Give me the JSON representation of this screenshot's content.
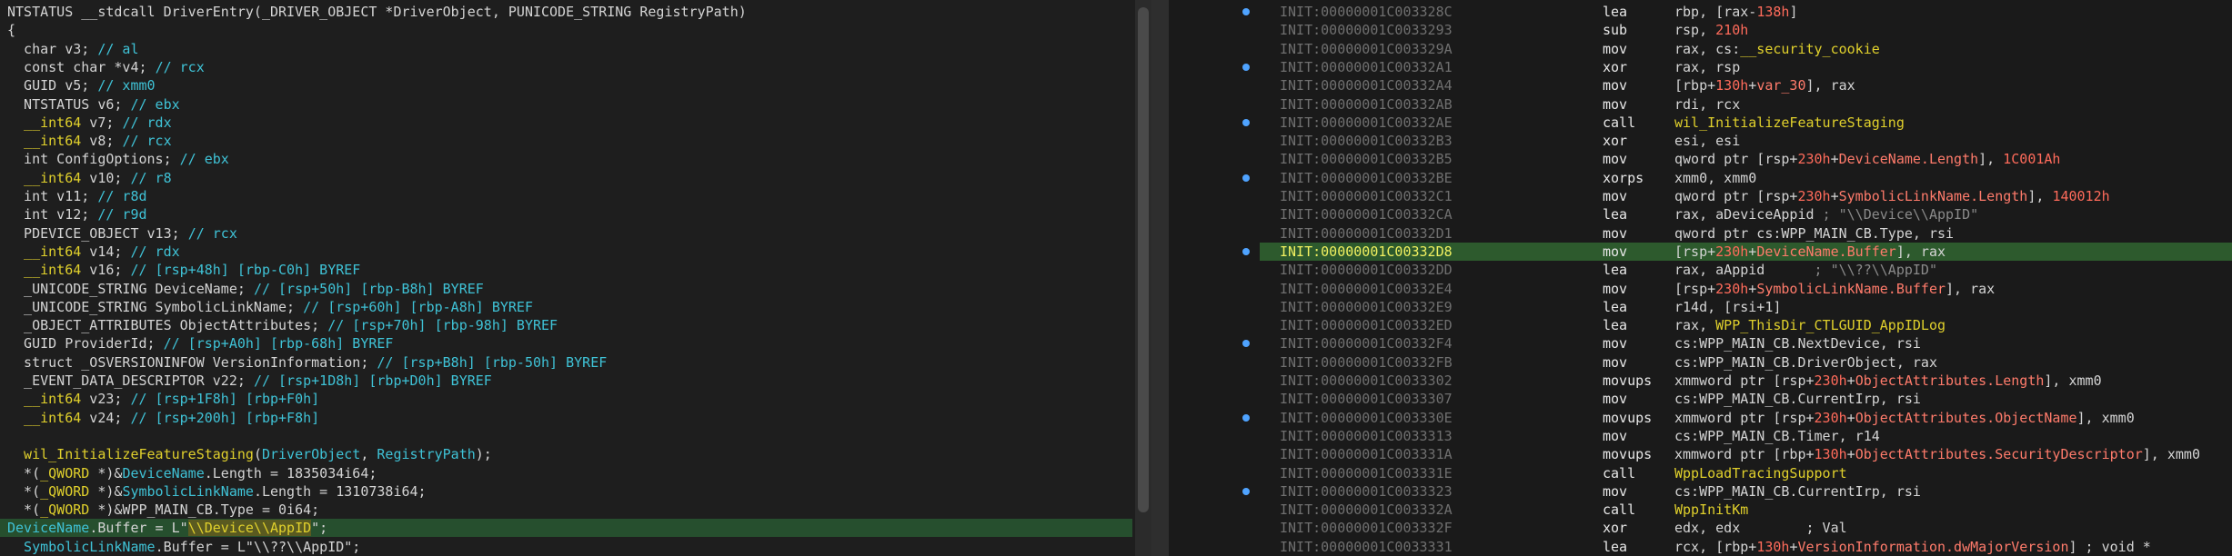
{
  "pseudocode": {
    "lines": [
      {
        "parts": [
          {
            "t": "NTSTATUS __stdcall DriverEntry(_DRIVER_OBJECT *DriverObject, PUNICODE_STRING RegistryPath)",
            "c": "kw"
          }
        ]
      },
      {
        "parts": [
          {
            "t": "{",
            "c": "kw"
          }
        ]
      },
      {
        "parts": [
          {
            "t": "  char v3; ",
            "c": "kw"
          },
          {
            "t": "// al",
            "c": "cmt"
          }
        ]
      },
      {
        "parts": [
          {
            "t": "  const char *v4; ",
            "c": "kw"
          },
          {
            "t": "// rcx",
            "c": "cmt"
          }
        ]
      },
      {
        "parts": [
          {
            "t": "  GUID v5; ",
            "c": "kw"
          },
          {
            "t": "// xmm0",
            "c": "cmt"
          }
        ]
      },
      {
        "parts": [
          {
            "t": "  NTSTATUS v6; ",
            "c": "kw"
          },
          {
            "t": "// ebx",
            "c": "cmt"
          }
        ]
      },
      {
        "parts": [
          {
            "t": "  __int64",
            "c": "fn"
          },
          {
            "t": " v7; ",
            "c": "kw"
          },
          {
            "t": "// rdx",
            "c": "cmt"
          }
        ]
      },
      {
        "parts": [
          {
            "t": "  __int64",
            "c": "fn"
          },
          {
            "t": " v8; ",
            "c": "kw"
          },
          {
            "t": "// rcx",
            "c": "cmt"
          }
        ]
      },
      {
        "parts": [
          {
            "t": "  int ConfigOptions; ",
            "c": "kw"
          },
          {
            "t": "// ebx",
            "c": "cmt"
          }
        ]
      },
      {
        "parts": [
          {
            "t": "  __int64",
            "c": "fn"
          },
          {
            "t": " v10; ",
            "c": "kw"
          },
          {
            "t": "// r8",
            "c": "cmt"
          }
        ]
      },
      {
        "parts": [
          {
            "t": "  int v11; ",
            "c": "kw"
          },
          {
            "t": "// r8d",
            "c": "cmt"
          }
        ]
      },
      {
        "parts": [
          {
            "t": "  int v12; ",
            "c": "kw"
          },
          {
            "t": "// r9d",
            "c": "cmt"
          }
        ]
      },
      {
        "parts": [
          {
            "t": "  PDEVICE_OBJECT v13; ",
            "c": "kw"
          },
          {
            "t": "// rcx",
            "c": "cmt"
          }
        ]
      },
      {
        "parts": [
          {
            "t": "  __int64",
            "c": "fn"
          },
          {
            "t": " v14; ",
            "c": "kw"
          },
          {
            "t": "// rdx",
            "c": "cmt"
          }
        ]
      },
      {
        "parts": [
          {
            "t": "  __int64",
            "c": "fn"
          },
          {
            "t": " v16; ",
            "c": "kw"
          },
          {
            "t": "// [rsp+48h] [rbp-C0h] BYREF",
            "c": "cmt"
          }
        ]
      },
      {
        "parts": [
          {
            "t": "  _UNICODE_STRING DeviceName; ",
            "c": "kw"
          },
          {
            "t": "// [rsp+50h] [rbp-B8h] BYREF",
            "c": "cmt"
          }
        ]
      },
      {
        "parts": [
          {
            "t": "  _UNICODE_STRING SymbolicLinkName; ",
            "c": "kw"
          },
          {
            "t": "// [rsp+60h] [rbp-A8h] BYREF",
            "c": "cmt"
          }
        ]
      },
      {
        "parts": [
          {
            "t": "  _OBJECT_ATTRIBUTES ObjectAttributes; ",
            "c": "kw"
          },
          {
            "t": "// [rsp+70h] [rbp-98h] BYREF",
            "c": "cmt"
          }
        ]
      },
      {
        "parts": [
          {
            "t": "  GUID ProviderId; ",
            "c": "kw"
          },
          {
            "t": "// [rsp+A0h] [rbp-68h] BYREF",
            "c": "cmt"
          }
        ]
      },
      {
        "parts": [
          {
            "t": "  struct _OSVERSIONINFOW VersionInformation; ",
            "c": "kw"
          },
          {
            "t": "// [rsp+B8h] [rbp-50h] BYREF",
            "c": "cmt"
          }
        ]
      },
      {
        "parts": [
          {
            "t": "  _EVENT_DATA_DESCRIPTOR v22; ",
            "c": "kw"
          },
          {
            "t": "// [rsp+1D8h] [rbp+D0h] BYREF",
            "c": "cmt"
          }
        ]
      },
      {
        "parts": [
          {
            "t": "  __int64",
            "c": "fn"
          },
          {
            "t": " v23; ",
            "c": "kw"
          },
          {
            "t": "// [rsp+1F8h] [rbp+F0h]",
            "c": "cmt"
          }
        ]
      },
      {
        "parts": [
          {
            "t": "  __int64",
            "c": "fn"
          },
          {
            "t": " v24; ",
            "c": "kw"
          },
          {
            "t": "// [rsp+200h] [rbp+F8h]",
            "c": "cmt"
          }
        ]
      },
      {
        "parts": [
          {
            "t": "",
            "c": "kw"
          }
        ]
      },
      {
        "parts": [
          {
            "t": "  wil_InitializeFeatureStaging",
            "c": "fn"
          },
          {
            "t": "(",
            "c": "kw"
          },
          {
            "t": "DriverObject",
            "c": "var"
          },
          {
            "t": ", ",
            "c": "kw"
          },
          {
            "t": "RegistryPath",
            "c": "var"
          },
          {
            "t": ");",
            "c": "kw"
          }
        ]
      },
      {
        "parts": [
          {
            "t": "  *(",
            "c": "kw"
          },
          {
            "t": "_QWORD",
            "c": "fn"
          },
          {
            "t": " *)&",
            "c": "kw"
          },
          {
            "t": "DeviceName",
            "c": "var"
          },
          {
            "t": ".Length = 1835034i64;",
            "c": "kw"
          }
        ]
      },
      {
        "parts": [
          {
            "t": "  *(",
            "c": "kw"
          },
          {
            "t": "_QWORD",
            "c": "fn"
          },
          {
            "t": " *)&",
            "c": "kw"
          },
          {
            "t": "SymbolicLinkName",
            "c": "var"
          },
          {
            "t": ".Length = 1310738i64;",
            "c": "kw"
          }
        ]
      },
      {
        "parts": [
          {
            "t": "  *(",
            "c": "kw"
          },
          {
            "t": "_QWORD",
            "c": "fn"
          },
          {
            "t": " *)&WPP_MAIN_CB.Type = 0i64;",
            "c": "kw"
          }
        ]
      },
      {
        "highlight": true,
        "parts": [
          {
            "t": "DeviceName",
            "c": "var"
          },
          {
            "t": ".Buffer = L\"",
            "c": "kw"
          },
          {
            "t": "\\\\Device\\\\AppID",
            "c": "strhl"
          },
          {
            "t": "\";",
            "c": "kw"
          }
        ]
      },
      {
        "parts": [
          {
            "t": "  SymbolicLinkName",
            "c": "var"
          },
          {
            "t": ".Buffer = L\"\\\\??\\\\AppID\";",
            "c": "kw"
          }
        ]
      }
    ]
  },
  "disasm": {
    "rows": [
      {
        "addr": "INIT:00000001C003328C",
        "mn": "lea",
        "ops": [
          {
            "t": "rbp, [rax-",
            "c": "kw"
          },
          {
            "t": "138h",
            "c": "red"
          },
          {
            "t": "]",
            "c": "kw"
          }
        ]
      },
      {
        "addr": "INIT:00000001C0033293",
        "mn": "sub",
        "ops": [
          {
            "t": "rsp, ",
            "c": "kw"
          },
          {
            "t": "210h",
            "c": "red"
          }
        ]
      },
      {
        "addr": "INIT:00000001C003329A",
        "mn": "mov",
        "ops": [
          {
            "t": "rax, cs:",
            "c": "kw"
          },
          {
            "t": "__security_cookie",
            "c": "sym"
          }
        ]
      },
      {
        "addr": "INIT:00000001C00332A1",
        "mn": "xor",
        "ops": [
          {
            "t": "rax, rsp",
            "c": "kw"
          }
        ]
      },
      {
        "addr": "INIT:00000001C00332A4",
        "mn": "mov",
        "ops": [
          {
            "t": "[rbp+",
            "c": "kw"
          },
          {
            "t": "130h",
            "c": "red"
          },
          {
            "t": "+",
            "c": "kw"
          },
          {
            "t": "var_30",
            "c": "offs"
          },
          {
            "t": "], rax",
            "c": "kw"
          }
        ]
      },
      {
        "addr": "INIT:00000001C00332AB",
        "mn": "mov",
        "ops": [
          {
            "t": "rdi, rcx",
            "c": "kw"
          }
        ]
      },
      {
        "addr": "INIT:00000001C00332AE",
        "mn": "call",
        "ops": [
          {
            "t": "wil_InitializeFeatureStaging",
            "c": "sym"
          }
        ]
      },
      {
        "addr": "INIT:00000001C00332B3",
        "mn": "xor",
        "ops": [
          {
            "t": "esi, esi",
            "c": "kw"
          }
        ]
      },
      {
        "addr": "INIT:00000001C00332B5",
        "mn": "mov",
        "ops": [
          {
            "t": "qword ptr [rsp+",
            "c": "kw"
          },
          {
            "t": "230h",
            "c": "red"
          },
          {
            "t": "+",
            "c": "kw"
          },
          {
            "t": "DeviceName.Length",
            "c": "offs"
          },
          {
            "t": "], ",
            "c": "kw"
          },
          {
            "t": "1C001Ah",
            "c": "red"
          }
        ]
      },
      {
        "addr": "INIT:00000001C00332BE",
        "mn": "xorps",
        "ops": [
          {
            "t": "xmm0, xmm0",
            "c": "kw"
          }
        ]
      },
      {
        "addr": "INIT:00000001C00332C1",
        "mn": "mov",
        "ops": [
          {
            "t": "qword ptr [rsp+",
            "c": "kw"
          },
          {
            "t": "230h",
            "c": "red"
          },
          {
            "t": "+",
            "c": "kw"
          },
          {
            "t": "SymbolicLinkName.Length",
            "c": "offs"
          },
          {
            "t": "], ",
            "c": "kw"
          },
          {
            "t": "140012h",
            "c": "red"
          }
        ]
      },
      {
        "addr": "INIT:00000001C00332CA",
        "mn": "lea",
        "ops": [
          {
            "t": "rax, aDeviceAppid ",
            "c": "kw"
          },
          {
            "t": "; \"\\\\Device\\\\AppID\"",
            "c": "gray"
          }
        ]
      },
      {
        "addr": "INIT:00000001C00332D1",
        "mn": "mov",
        "ops": [
          {
            "t": "qword ptr cs:WPP_MAIN_CB.Type, rsi",
            "c": "kw"
          }
        ]
      },
      {
        "addr": "INIT:00000001C00332D8",
        "mn": "mov",
        "highlight": true,
        "ops": [
          {
            "t": "[rsp+",
            "c": "kw"
          },
          {
            "t": "230h",
            "c": "red"
          },
          {
            "t": "+",
            "c": "kw"
          },
          {
            "t": "DeviceName.Buffer",
            "c": "offs"
          },
          {
            "t": "], rax",
            "c": "kw"
          }
        ]
      },
      {
        "addr": "INIT:00000001C00332DD",
        "mn": "lea",
        "ops": [
          {
            "t": "rax, aAppid      ",
            "c": "kw"
          },
          {
            "t": "; \"\\\\??\\\\AppID\"",
            "c": "gray"
          }
        ]
      },
      {
        "addr": "INIT:00000001C00332E4",
        "mn": "mov",
        "ops": [
          {
            "t": "[rsp+",
            "c": "kw"
          },
          {
            "t": "230h",
            "c": "red"
          },
          {
            "t": "+",
            "c": "kw"
          },
          {
            "t": "SymbolicLinkName.Buffer",
            "c": "offs"
          },
          {
            "t": "], rax",
            "c": "kw"
          }
        ]
      },
      {
        "addr": "INIT:00000001C00332E9",
        "mn": "lea",
        "ops": [
          {
            "t": "r14d, [rsi+1]",
            "c": "kw"
          }
        ]
      },
      {
        "addr": "INIT:00000001C00332ED",
        "mn": "lea",
        "ops": [
          {
            "t": "rax, ",
            "c": "kw"
          },
          {
            "t": "WPP_ThisDir_CTLGUID_AppIDLog",
            "c": "sym"
          }
        ]
      },
      {
        "addr": "INIT:00000001C00332F4",
        "mn": "mov",
        "ops": [
          {
            "t": "cs:WPP_MAIN_CB.NextDevice, rsi",
            "c": "kw"
          }
        ]
      },
      {
        "addr": "INIT:00000001C00332FB",
        "mn": "mov",
        "ops": [
          {
            "t": "cs:WPP_MAIN_CB.DriverObject, rax",
            "c": "kw"
          }
        ]
      },
      {
        "addr": "INIT:00000001C0033302",
        "mn": "movups",
        "ops": [
          {
            "t": "xmmword ptr [rsp+",
            "c": "kw"
          },
          {
            "t": "230h",
            "c": "red"
          },
          {
            "t": "+",
            "c": "kw"
          },
          {
            "t": "ObjectAttributes.Length",
            "c": "offs"
          },
          {
            "t": "], xmm0",
            "c": "kw"
          }
        ]
      },
      {
        "addr": "INIT:00000001C0033307",
        "mn": "mov",
        "ops": [
          {
            "t": "cs:WPP_MAIN_CB.CurrentIrp, rsi",
            "c": "kw"
          }
        ]
      },
      {
        "addr": "INIT:00000001C003330E",
        "mn": "movups",
        "ops": [
          {
            "t": "xmmword ptr [rsp+",
            "c": "kw"
          },
          {
            "t": "230h",
            "c": "red"
          },
          {
            "t": "+",
            "c": "kw"
          },
          {
            "t": "ObjectAttributes.ObjectName",
            "c": "offs"
          },
          {
            "t": "], xmm0",
            "c": "kw"
          }
        ]
      },
      {
        "addr": "INIT:00000001C0033313",
        "mn": "mov",
        "ops": [
          {
            "t": "cs:WPP_MAIN_CB.Timer, r14",
            "c": "kw"
          }
        ]
      },
      {
        "addr": "INIT:00000001C003331A",
        "mn": "movups",
        "ops": [
          {
            "t": "xmmword ptr [rbp+",
            "c": "kw"
          },
          {
            "t": "130h",
            "c": "red"
          },
          {
            "t": "+",
            "c": "kw"
          },
          {
            "t": "ObjectAttributes.SecurityDescriptor",
            "c": "offs"
          },
          {
            "t": "], xmm0",
            "c": "kw"
          }
        ]
      },
      {
        "addr": "INIT:00000001C003331E",
        "mn": "call",
        "ops": [
          {
            "t": "WppLoadTracingSupport",
            "c": "sym"
          }
        ]
      },
      {
        "addr": "INIT:00000001C0033323",
        "mn": "mov",
        "ops": [
          {
            "t": "cs:WPP_MAIN_CB.CurrentIrp, rsi",
            "c": "kw"
          }
        ]
      },
      {
        "addr": "INIT:00000001C003332A",
        "mn": "call",
        "ops": [
          {
            "t": "WppInitKm",
            "c": "sym"
          }
        ]
      },
      {
        "addr": "INIT:00000001C003332F",
        "mn": "xor",
        "ops": [
          {
            "t": "edx, edx        ",
            "c": "kw"
          },
          {
            "t": "; Val",
            "c": "kw"
          }
        ]
      },
      {
        "addr": "INIT:00000001C0033331",
        "mn": "lea",
        "ops": [
          {
            "t": "rcx, [rbp+",
            "c": "kw"
          },
          {
            "t": "130h",
            "c": "red"
          },
          {
            "t": "+",
            "c": "kw"
          },
          {
            "t": "VersionInformation.dwMajorVersion",
            "c": "offs"
          },
          {
            "t": "] ; void *",
            "c": "kw"
          }
        ]
      }
    ]
  },
  "gutter": {
    "dot_rows": [
      0,
      3,
      6,
      9,
      13,
      18,
      22,
      26
    ]
  }
}
